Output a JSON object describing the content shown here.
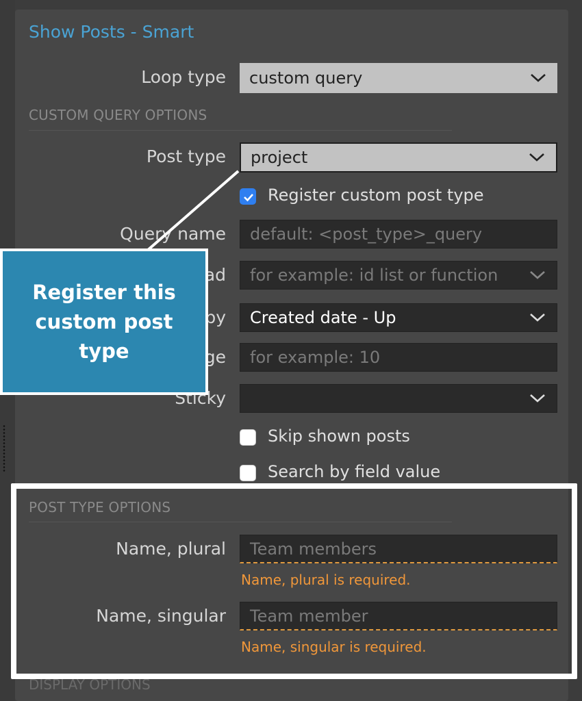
{
  "panel": {
    "title": "Show Posts - Smart"
  },
  "loop_type": {
    "label": "Loop type",
    "value": "custom query"
  },
  "custom_query": {
    "heading": "CUSTOM QUERY OPTIONS",
    "post_type": {
      "label": "Post type",
      "value": "project"
    },
    "register_checkbox": {
      "label": "Register custom post type",
      "checked": true
    },
    "query_name": {
      "label": "Query name",
      "placeholder": "default: <post_type>_query"
    },
    "load": {
      "label": "ad",
      "placeholder": "for example: id list or function"
    },
    "order_by": {
      "label": "by",
      "value": "Created date - Up"
    },
    "per_page": {
      "label": "ge",
      "placeholder": "for example: 10"
    },
    "sticky": {
      "label": "Sticky",
      "value": ""
    },
    "skip_shown": {
      "label": "Skip shown posts",
      "checked": false
    },
    "search_field": {
      "label": "Search by field value",
      "checked": false
    }
  },
  "post_type_options": {
    "heading": "POST TYPE OPTIONS",
    "name_plural": {
      "label": "Name, plural",
      "placeholder": "Team members",
      "error": "Name, plural is required."
    },
    "name_singular": {
      "label": "Name, singular",
      "placeholder": "Team member",
      "error": "Name, singular is required."
    }
  },
  "display_options": {
    "heading": "DISPLAY OPTIONS"
  },
  "callout": {
    "text": "Register this custom post type"
  },
  "colors": {
    "accent": "#4aa3d4",
    "callout_bg": "#2c87b0",
    "error": "#f0973a",
    "checkbox_checked": "#2f7ff0"
  },
  "icons": {
    "select_arrow": "chevron-down-icon",
    "checkmark": "checkmark-icon"
  }
}
